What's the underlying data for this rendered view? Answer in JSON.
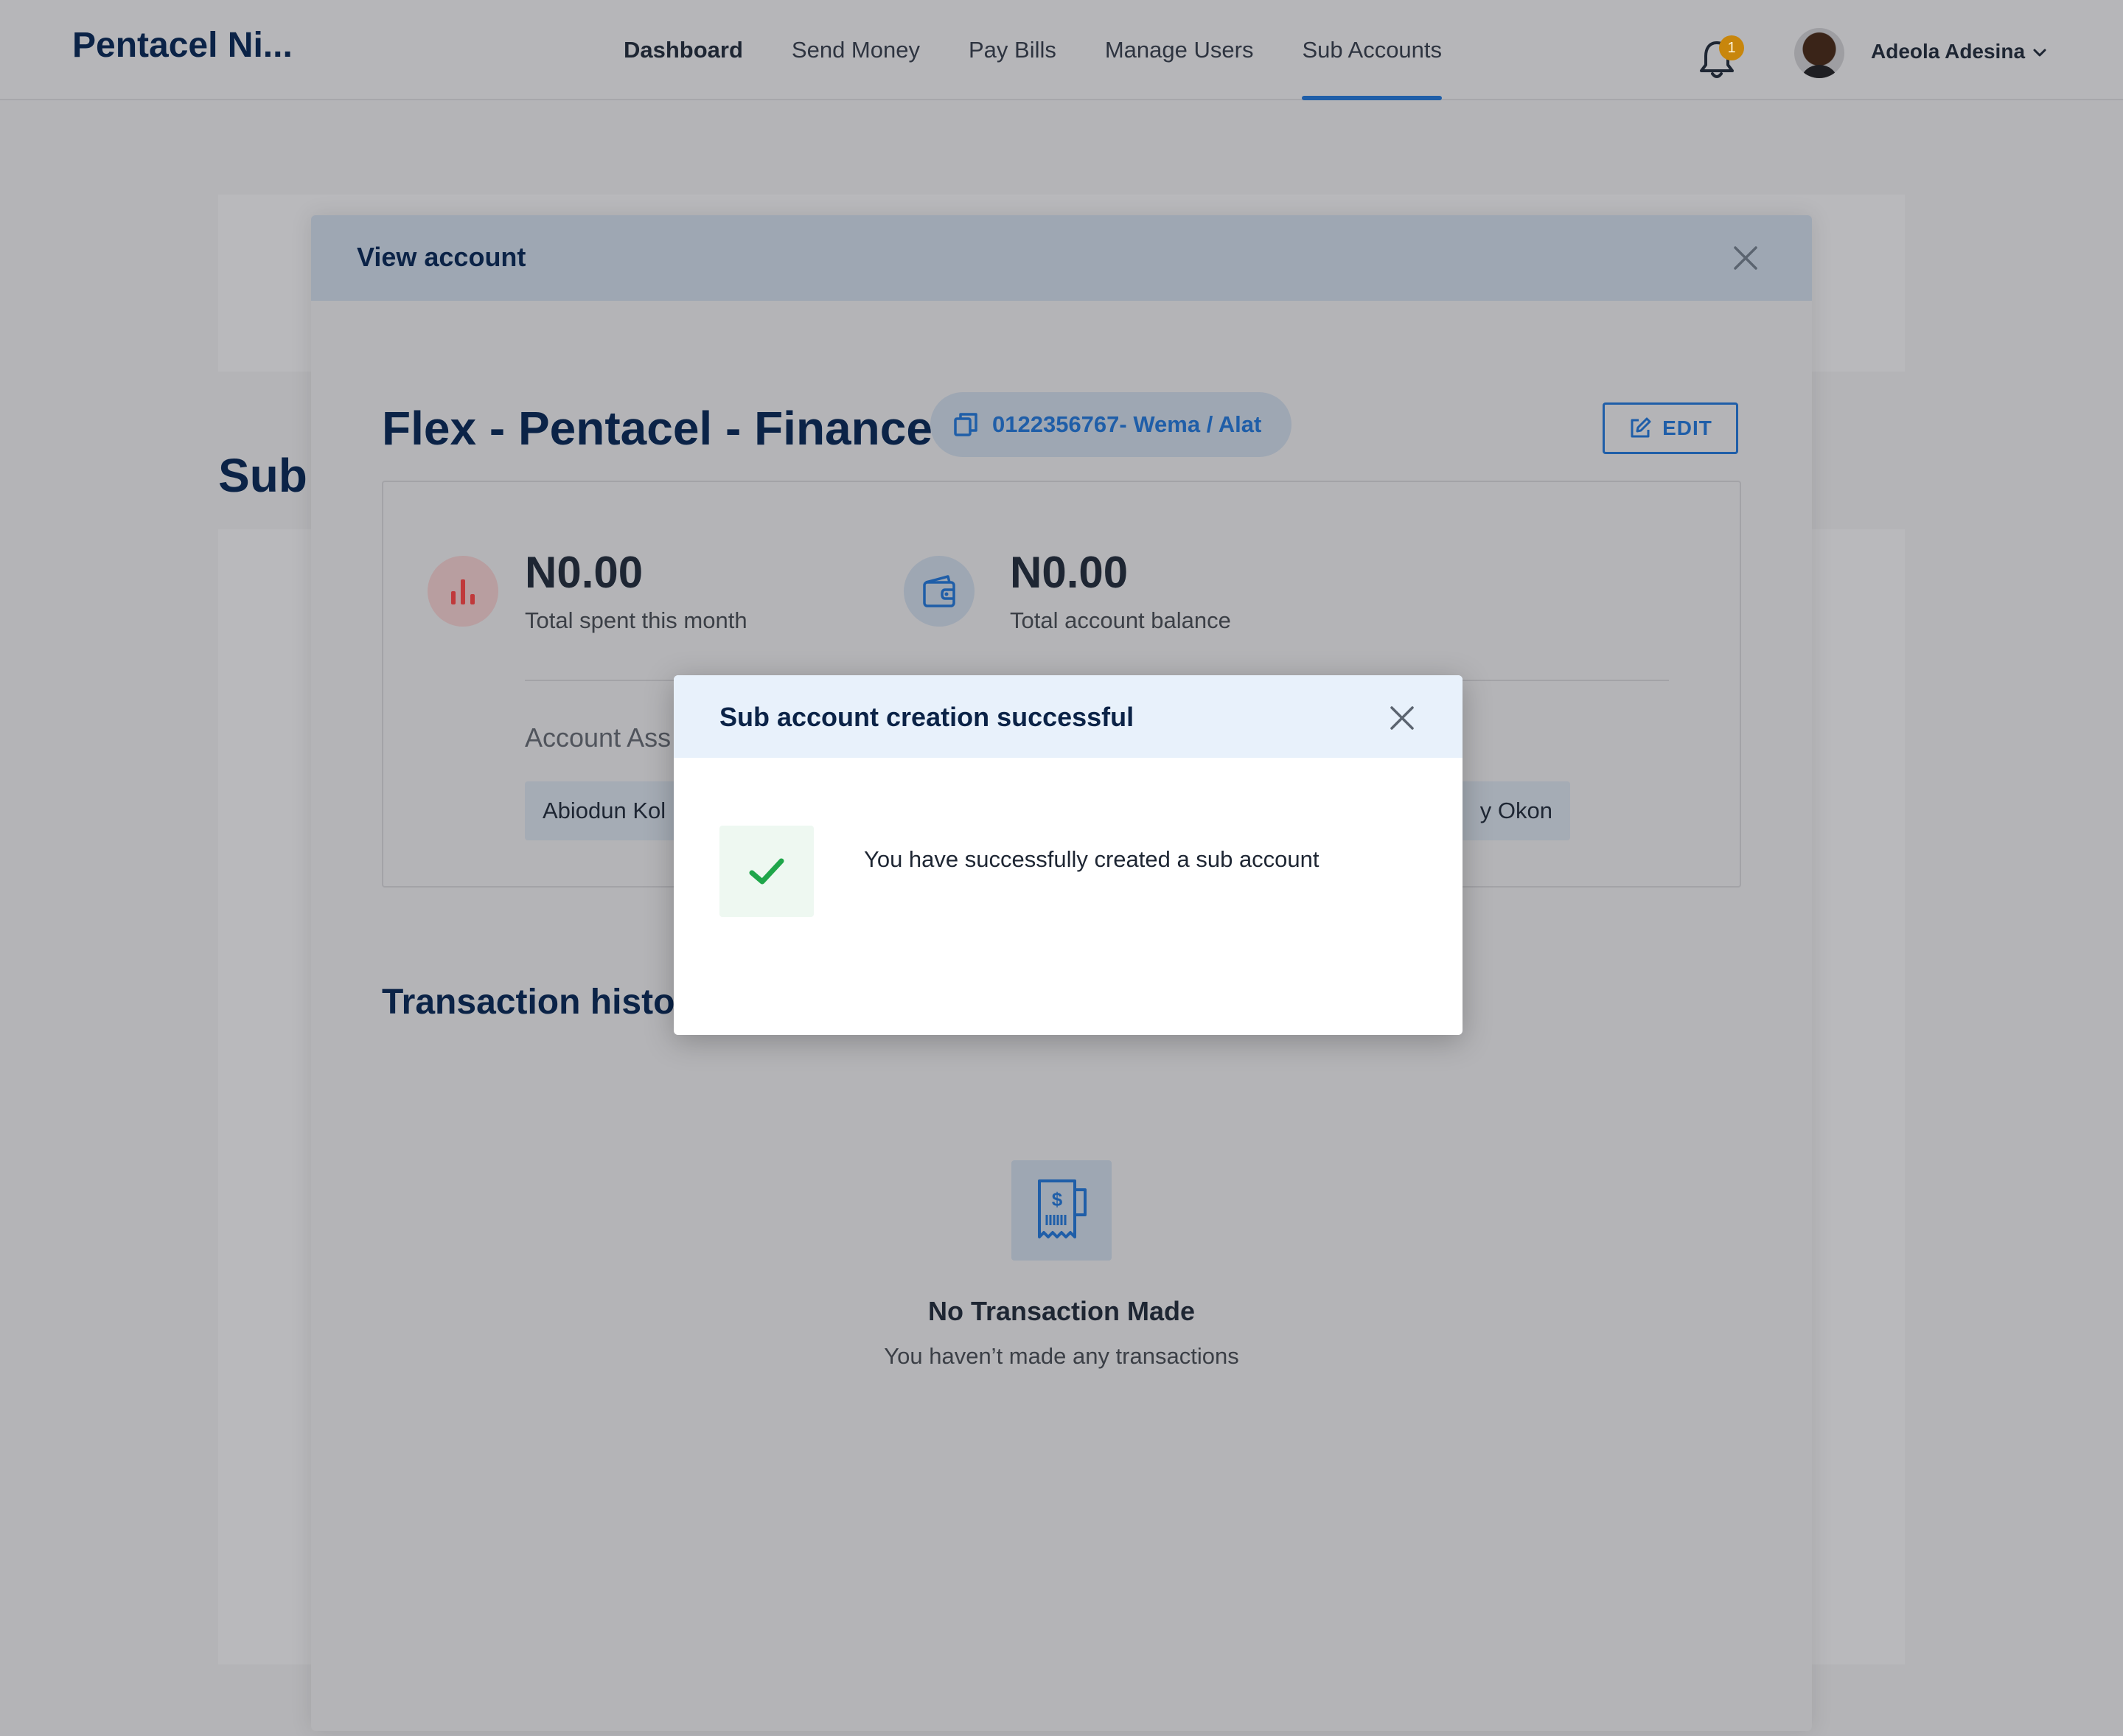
{
  "header": {
    "brand": "Pentacel Ni...",
    "nav": [
      {
        "label": "Dashboard"
      },
      {
        "label": "Send Money"
      },
      {
        "label": "Pay Bills"
      },
      {
        "label": "Manage Users"
      },
      {
        "label": "Sub Accounts",
        "active": true
      }
    ],
    "notification_count": "1",
    "user_name": "Adeola Adesina"
  },
  "background_page": {
    "title": "Sub"
  },
  "view_account_modal": {
    "title": "View account",
    "account_name": "Flex - Pentacel - Finance",
    "account_pill": "0122356767- Wema / Alat",
    "edit_label": "EDIT",
    "stats": {
      "spent_amount": "N0.00",
      "spent_label": "Total spent this month",
      "balance_amount": "N0.00",
      "balance_label": "Total account balance"
    },
    "assigned_label": "Account Ass",
    "assigned_users": [
      "Abiodun Kol",
      "y Okon"
    ],
    "transaction_title": "Transaction histor",
    "empty_title": "No Transaction Made",
    "empty_subtitle": "You haven’t made any transactions"
  },
  "success_dialog": {
    "title": "Sub account creation successful",
    "message": "You have successfully created a sub account"
  },
  "colors": {
    "brand_navy": "#0b2347",
    "accent_blue": "#1f5ea8",
    "success_green": "#1fa64a",
    "badge_orange": "#c8860c",
    "stat_red": "#c0393b"
  }
}
